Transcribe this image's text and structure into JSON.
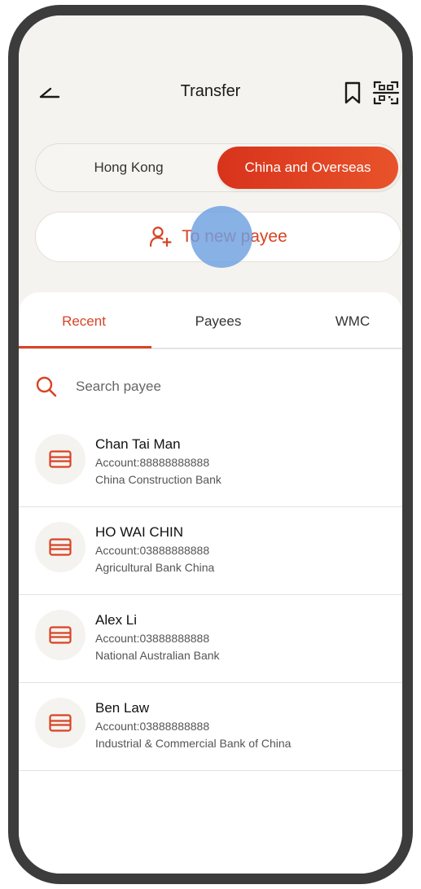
{
  "header": {
    "title": "Transfer",
    "back_icon": "back-arrow-icon",
    "bookmark_icon": "bookmark-icon",
    "scan_icon": "qr-scan-icon"
  },
  "segment": {
    "options": [
      {
        "label": "Hong Kong",
        "selected": false
      },
      {
        "label": "China and Overseas",
        "selected": true
      }
    ]
  },
  "new_payee": {
    "label": "To new payee",
    "icon": "add-user-icon"
  },
  "tabs": [
    {
      "label": "Recent",
      "active": true
    },
    {
      "label": "Payees",
      "active": false
    },
    {
      "label": "WMC",
      "active": false
    }
  ],
  "search": {
    "placeholder": "Search payee",
    "value": ""
  },
  "payees": [
    {
      "name": "Chan Tai Man",
      "account": "Account:88888888888",
      "bank": "China Construction Bank"
    },
    {
      "name": "HO WAI CHIN",
      "account": "Account:03888888888",
      "bank": "Agricultural Bank China"
    },
    {
      "name": "Alex Li",
      "account": "Account:03888888888",
      "bank": "National Australian Bank"
    },
    {
      "name": "Ben Law",
      "account": "Account:03888888888",
      "bank": "Industrial & Commercial Bank of China"
    }
  ],
  "colors": {
    "accent": "#d84325",
    "accent_gradient_end": "#e8532a",
    "top_background": "#f5f3ef",
    "frame": "#3c3c3c",
    "touch_indicator": "#6ea0e1"
  }
}
